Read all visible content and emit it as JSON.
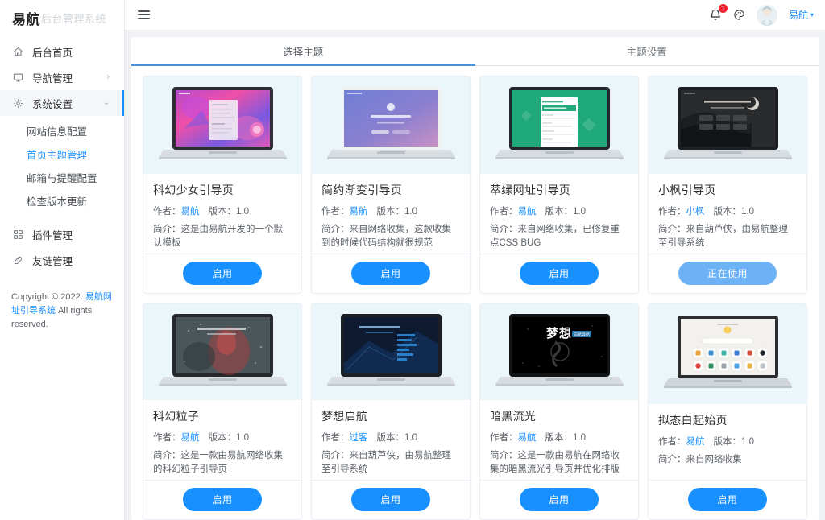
{
  "sidebar": {
    "logo_main": "易航",
    "logo_sub": "后台管理系统",
    "items": [
      {
        "label": "后台首页",
        "icon": "home-icon",
        "arrow": ""
      },
      {
        "label": "导航管理",
        "icon": "monitor-icon",
        "arrow": "›"
      },
      {
        "label": "系统设置",
        "icon": "gear-icon",
        "arrow": "⌄"
      },
      {
        "label": "插件管理",
        "icon": "grid-icon",
        "arrow": ""
      },
      {
        "label": "友链管理",
        "icon": "link-icon",
        "arrow": ""
      }
    ],
    "submenu": [
      {
        "label": "网站信息配置"
      },
      {
        "label": "首页主题管理"
      },
      {
        "label": "邮箱与提醒配置"
      },
      {
        "label": "检查版本更新"
      }
    ],
    "copyright_prefix": "Copyright © 2022. ",
    "copyright_link": "易航网址引导系统",
    "copyright_suffix": " All rights reserved."
  },
  "topbar": {
    "menu_toggle": "hamburger-icon",
    "bell_badge": "1",
    "user_name": "易航",
    "caret": "▾"
  },
  "tabs": [
    {
      "label": "选择主题",
      "active": true
    },
    {
      "label": "主题设置",
      "active": false
    }
  ],
  "labels": {
    "author": "作者：",
    "version": "版本：1.0",
    "intro": "简介："
  },
  "themes": [
    {
      "name": "科幻少女引导页",
      "author": "易航",
      "version": "版本：1.0",
      "desc": "这是由易航开发的一个默认模板",
      "button": "启用",
      "in_use": false,
      "thumb_style": "scifi-girl"
    },
    {
      "name": "简约渐变引导页",
      "author": "易航",
      "version": "版本：1.0",
      "desc": "来自网络收集，这款收集到的时候代码结构就很规范",
      "button": "启用",
      "in_use": false,
      "thumb_style": "gradient"
    },
    {
      "name": "萃绿网址引导页",
      "author": "易航",
      "version": "版本：1.0",
      "desc": "来自网络收集，已修复重点CSS BUG",
      "button": "启用",
      "in_use": false,
      "thumb_style": "green"
    },
    {
      "name": "小枫引导页",
      "author": "小枫",
      "version": "版本：1.0",
      "desc": "来自葫芦侠，由易航整理至引导系统",
      "button": "正在使用",
      "in_use": true,
      "thumb_style": "dark-maple"
    },
    {
      "name": "科幻粒子",
      "author": "易航",
      "version": "版本：1.0",
      "desc": "这是一款由易航网络收集的科幻粒子引导页",
      "button": "启用",
      "in_use": false,
      "thumb_style": "particle"
    },
    {
      "name": "梦想启航",
      "author": "过客",
      "version": "版本：1.0",
      "desc": "来自葫芦侠，由易航整理至引导系统",
      "button": "启用",
      "in_use": false,
      "thumb_style": "blue-tech"
    },
    {
      "name": "暗黑流光",
      "author": "易航",
      "version": "版本：1.0",
      "desc": "这是一款由易航在网络收集的暗黑流光引导页并优化排版",
      "button": "启用",
      "in_use": false,
      "thumb_style": "black-dream"
    },
    {
      "name": "拟态白起始页",
      "author": "易航",
      "version": "版本：1.0",
      "desc": "来自网络收集",
      "button": "启用",
      "in_use": false,
      "thumb_style": "white-neu"
    }
  ],
  "colors": {
    "accent": "#1890ff",
    "accent_light": "#6cb2f5",
    "badge": "#f5222d",
    "thumb_bg": "#eaf6f9"
  }
}
